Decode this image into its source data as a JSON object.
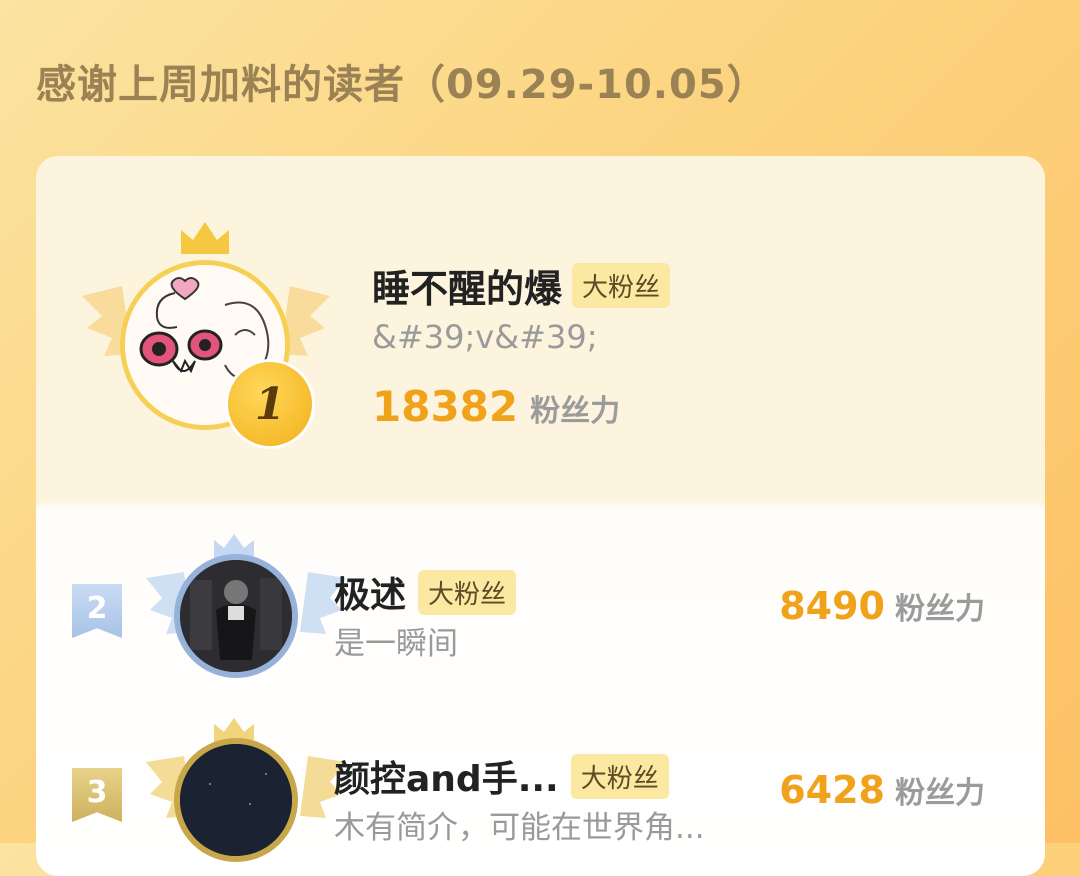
{
  "header": {
    "title": "感谢上周加料的读者（09.29-10.05）"
  },
  "colors": {
    "accent": "#f0a21a",
    "gold": "#f6cf55",
    "silver": "#97b2d9",
    "bronze": "#c8a64a"
  },
  "ranking": [
    {
      "rank": "1",
      "name": "睡不醒的爆",
      "badge": "大粉丝",
      "bio": "&#39;v&#39;",
      "score": "18382",
      "unit": "粉丝力"
    },
    {
      "rank": "2",
      "name": "极述",
      "badge": "大粉丝",
      "bio": "是一瞬间",
      "score": "8490",
      "unit": "粉丝力"
    },
    {
      "rank": "3",
      "name": "颜控and手...",
      "badge": "大粉丝",
      "bio": "木有简介，可能在世界角...",
      "score": "6428",
      "unit": "粉丝力"
    }
  ]
}
